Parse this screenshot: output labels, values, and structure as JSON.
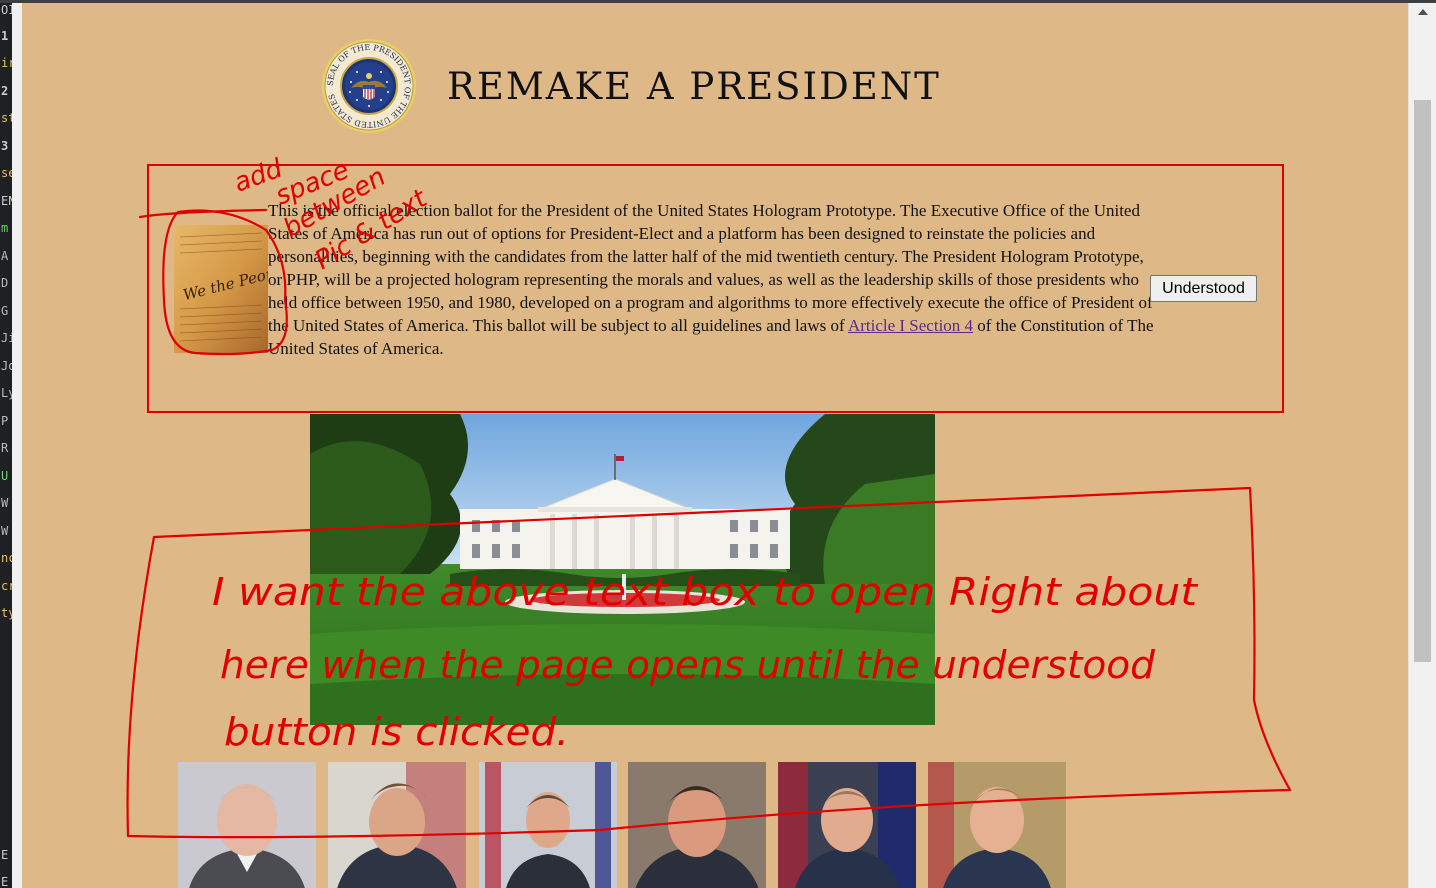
{
  "page": {
    "title": "REMAKE A PRESIDENT",
    "seal_text": "SEAL OF THE PRESIDENT OF THE UNITED STATES",
    "intro": {
      "text_before_link": "This is the official election ballot for the President of the United States Hologram Prototype. The Executive Office of the United States of America has run out of options for President-Elect and a platform has been designed to reinstate the policies and personalities, beginning with the candidates from the latter half of the mid twentieth century. The President Hologram Prototype, or PHP, will be a projected hologram representing the morals and values, as well as the leadership skills of those presidents who held office between 1950, and 1980, developed on a program and algorithms to more effectively execute the office of President of the United States of America. This ballot will be subject to all guidelines and laws of ",
      "link_text": "Article I Section 4",
      "text_after_link": " of the Constitution of The United States of America.",
      "button_label": "Understood",
      "constitution_caption": "We the People"
    },
    "portraits": [
      "portrait-1",
      "portrait-2",
      "portrait-3",
      "portrait-4",
      "portrait-5",
      "portrait-6"
    ]
  },
  "annotations": {
    "note_small": [
      "add",
      "space",
      "between",
      "Pic & text"
    ],
    "note_large": [
      "I want the above text box to open Right about",
      "here when the page opens until the understood",
      "button is clicked."
    ],
    "color": "#e00000"
  },
  "editor_gutter": {
    "chars": [
      "OI",
      "1",
      "ir",
      "2",
      "st",
      "3",
      "se",
      "EN",
      "m",
      "A",
      "D",
      "G",
      "Ji",
      "Jo",
      "Ly",
      "P",
      "R",
      "U",
      "W",
      "W",
      "nc",
      "cr",
      "ty",
      "E",
      "E"
    ]
  },
  "colors": {
    "page_background": "#deb887",
    "annotation_red": "#e00000",
    "link": "#5a2a8a"
  }
}
